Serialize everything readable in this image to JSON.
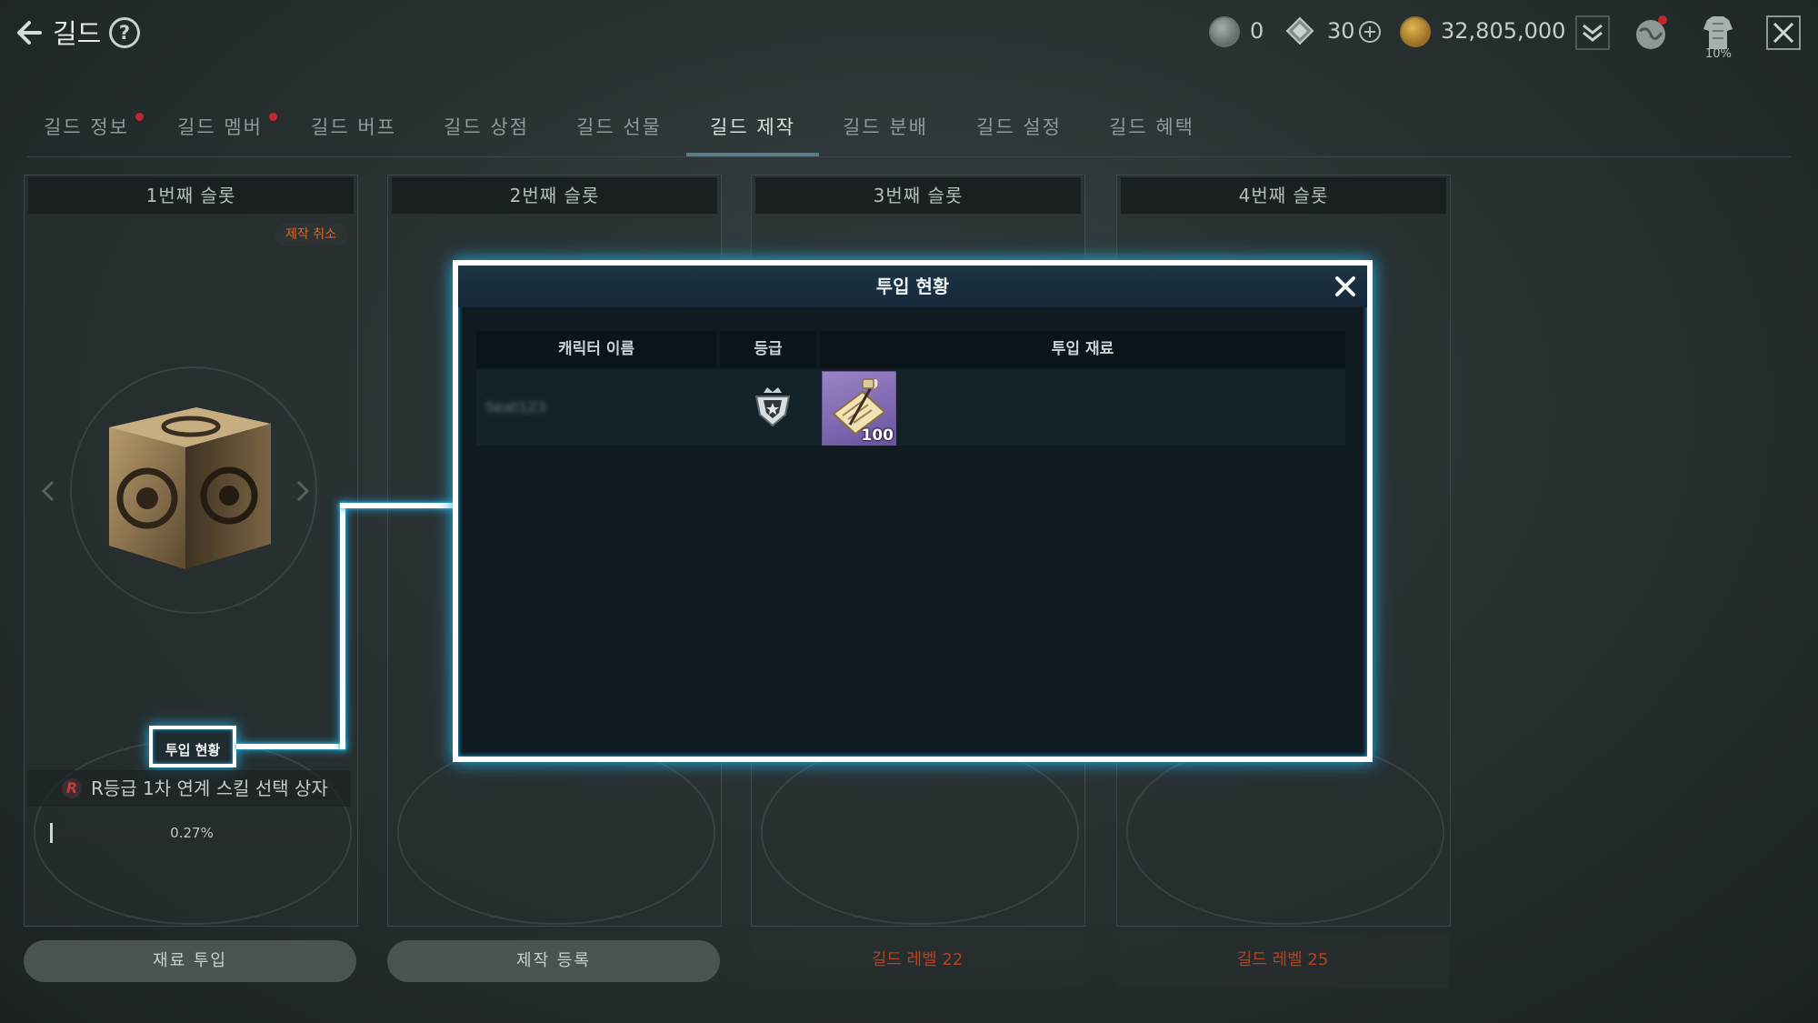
{
  "header": {
    "title": "길드",
    "resources": [
      {
        "name": "silver-coin",
        "value": "0"
      },
      {
        "name": "diamond",
        "value": "30"
      },
      {
        "name": "gold",
        "value": "32,805,000"
      }
    ],
    "inventory_percent": "10%"
  },
  "tabs": [
    {
      "label": "길드 정보",
      "dot": true
    },
    {
      "label": "길드 멤버",
      "dot": true
    },
    {
      "label": "길드 버프",
      "dot": false
    },
    {
      "label": "길드 상점",
      "dot": false
    },
    {
      "label": "길드 선물",
      "dot": false
    },
    {
      "label": "길드 제작",
      "dot": false,
      "active": true
    },
    {
      "label": "길드 분배",
      "dot": false
    },
    {
      "label": "길드 설정",
      "dot": false
    },
    {
      "label": "길드 혜택",
      "dot": false
    }
  ],
  "slots": [
    {
      "title": "1번째 슬롯",
      "cancel_label": "제작 취소",
      "inputs_status_label": "투입 현황",
      "item_rank": "R",
      "item_name": "R등급 1차 연계 스킬 선택 상자",
      "progress_percent": 0.27,
      "progress_text": "0.27%",
      "button_label": "재료 투입"
    },
    {
      "title": "2번째 슬롯",
      "button_label": "제작 등록"
    },
    {
      "title": "3번째 슬롯",
      "requirement": "길드 레벨 22"
    },
    {
      "title": "4번째 슬롯",
      "requirement": "길드 레벨 25"
    }
  ],
  "popup": {
    "title": "투입 현황",
    "columns": [
      "캐릭터 이름",
      "등급",
      "투입 재료"
    ],
    "rows": [
      {
        "character_name": "Seat123",
        "grade_icon": "crown-shield-icon",
        "material_icon": "scroll-quill-icon",
        "material_count": "100"
      }
    ]
  },
  "colors": {
    "highlight_glow": "#25b6ef",
    "locked_text": "#b2421f",
    "cancel_text": "#d86a2c",
    "notification_dot": "#c0282b"
  }
}
